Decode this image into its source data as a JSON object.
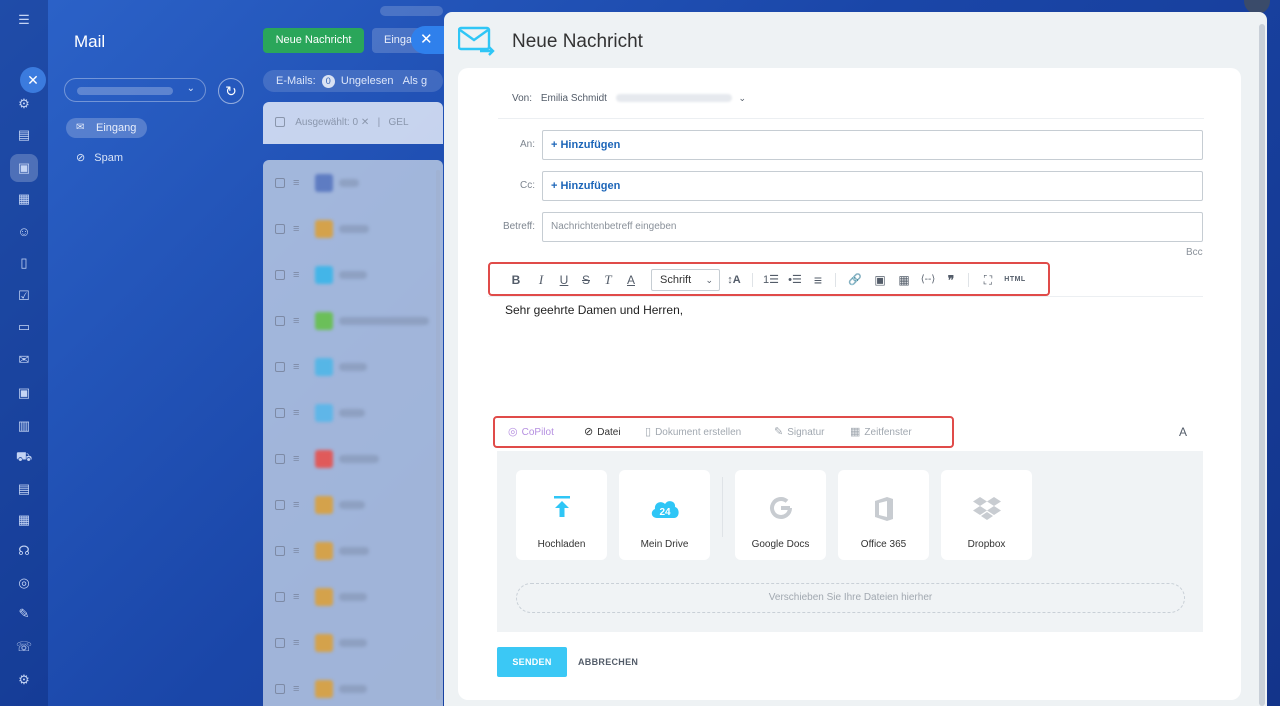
{
  "background": {
    "app_title": "Mail",
    "new_message_button": "Neue Nachricht",
    "inbox_button": "Eingang",
    "stats": {
      "label": "E-Mails:",
      "unread_count": "0",
      "unread_label": "Ungelesen",
      "more": "Als g"
    },
    "selection": {
      "label": "Ausgewählt: 0",
      "clear": "✕",
      "action": "GEL"
    },
    "folders": [
      {
        "label": "Eingang",
        "icon": "inbox-icon"
      },
      {
        "label": "Spam",
        "icon": "block-icon"
      }
    ],
    "rail_icons": [
      "menu-icon",
      "close-icon",
      "settings-icon",
      "feed-icon",
      "chat-icon",
      "calendar-icon",
      "contacts-icon",
      "document-icon",
      "tasks-icon",
      "crm-icon",
      "mail-icon",
      "sites-icon",
      "analytics-icon",
      "shop-icon",
      "marketing-icon",
      "planner-icon",
      "automation-icon",
      "copilot-icon",
      "signature-icon",
      "support-icon",
      "gear-icon"
    ],
    "list_avatar_colors": [
      "#5e7cc2",
      "#d4a24b",
      "#43b5e8",
      "#6bbf59",
      "#56b6e6",
      "#5fb6e8",
      "#e05a5a",
      "#d4a24b",
      "#d4a24b",
      "#d4a24b",
      "#d4a24b",
      "#d4a24b"
    ]
  },
  "composer": {
    "title": "Neue Nachricht",
    "close_icon": "close-icon",
    "from": {
      "label": "Von:",
      "name": "Emilia Schmidt"
    },
    "to": {
      "label": "An:",
      "add": "+ Hinzufügen"
    },
    "cc": {
      "label": "Cc:",
      "add": "+ Hinzufügen"
    },
    "subject": {
      "label": "Betreff:",
      "placeholder": "Nachrichtenbetreff eingeben"
    },
    "bcc": "Bcc",
    "toolbar": {
      "bold": "B",
      "italic": "I",
      "underline": "U",
      "strike": "S",
      "clear_format": "T",
      "font_color": "A",
      "font_select": "Schrift",
      "font_size": "↕A",
      "ordered_list": "1☰",
      "bullet_list": "•☰",
      "align": "≡",
      "link": "🔗",
      "image": "▣",
      "table": "▦",
      "code": "⟨--⟩",
      "quote": "❞",
      "fullscreen": "⛶",
      "html": "HTML"
    },
    "body_text": "Sehr geehrte Damen und Herren,",
    "attach_bar": {
      "copilot": "CoPilot",
      "file": "Datei",
      "create_doc": "Dokument erstellen",
      "signature": "Signatur",
      "timeslot": "Zeitfenster"
    },
    "font_toggle": "A",
    "upload_tiles": [
      {
        "label": "Hochladen",
        "icon": "upload-icon"
      },
      {
        "label": "Mein Drive",
        "icon": "drive-icon",
        "badge": "24"
      },
      {
        "label": "Google Docs",
        "icon": "google-icon"
      },
      {
        "label": "Office 365",
        "icon": "office-icon"
      },
      {
        "label": "Dropbox",
        "icon": "dropbox-icon"
      }
    ],
    "dropzone": "Verschieben Sie Ihre Dateien hierher",
    "send": "SENDEN",
    "cancel": "ABBRECHEN"
  },
  "colors": {
    "accent_blue": "#2f80ec",
    "send_button": "#3bc8f5",
    "new_button": "#2aa65a",
    "highlight_red": "#e04b49",
    "link_blue": "#1c65b8"
  }
}
